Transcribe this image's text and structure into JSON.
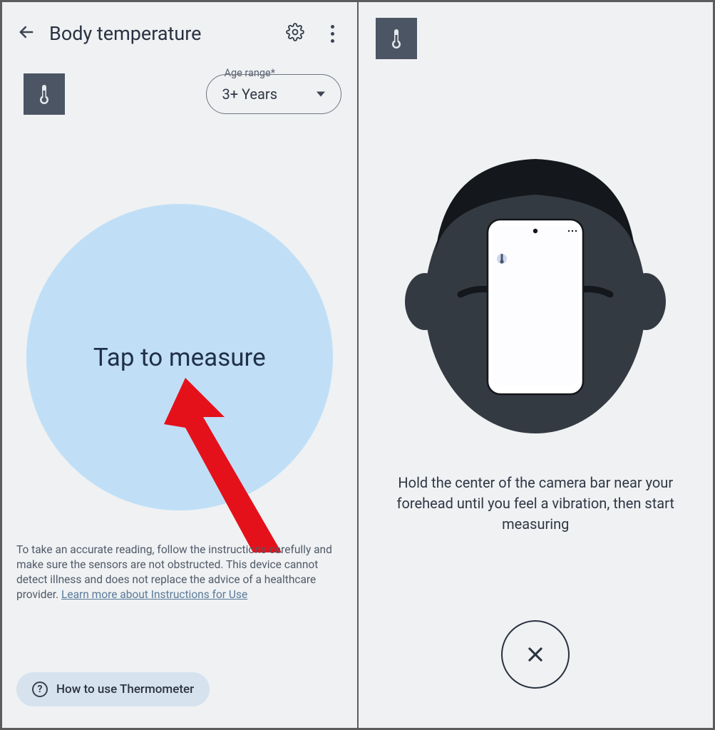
{
  "left": {
    "title": "Body temperature",
    "age_label": "Age range*",
    "age_value": "3+ Years",
    "measure_label": "Tap to measure",
    "disclaimer_text": "To take an accurate reading, follow the instructions carefully and make sure the sensors are not obstructed. This device cannot detect illness and does not replace the advice of a healthcare provider. ",
    "disclaimer_link": "Learn more about Instructions for Use",
    "howto_label": "How to use Thermometer"
  },
  "right": {
    "instruction": "Hold the center of the camera bar near your forehead until you feel a vibration, then start measuring"
  }
}
